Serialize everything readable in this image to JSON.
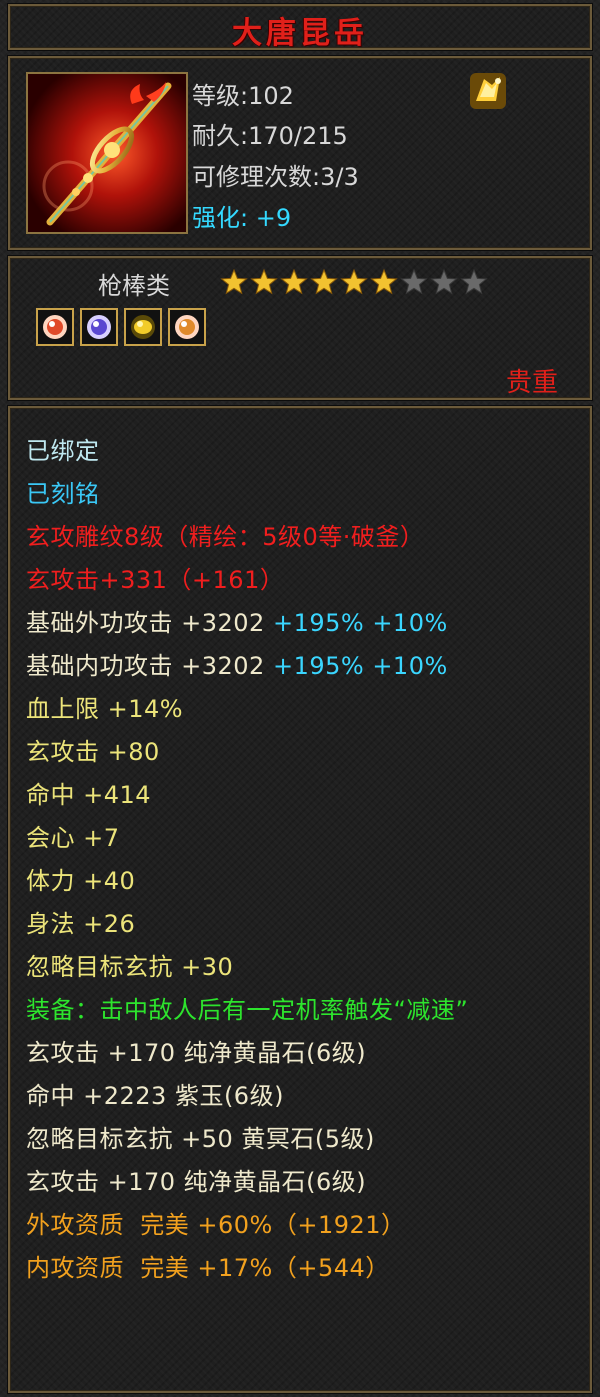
{
  "item": {
    "name": "大唐昆岳",
    "level": "等级:102",
    "durability": "耐久:170/215",
    "repairs": "可修理次数:3/3",
    "enhance_label": "强化:",
    "enhance_value": "+9",
    "category": "枪棒类",
    "rarity": "贵重"
  },
  "stars": {
    "total": 9,
    "filled": 6
  },
  "gems": [
    {
      "icon": "red-jewel-icon"
    },
    {
      "icon": "purple-jewel-icon"
    },
    {
      "icon": "yellow-jewel-icon"
    },
    {
      "icon": "red-jewel-icon"
    }
  ],
  "colors": {
    "title": "#e0201a",
    "enhance": "#34d9ff",
    "bound": "#bfe8f0",
    "engraved": "#3ac8f6",
    "carving": "#f01e1e",
    "stat": "#efe9cc",
    "effect": "#2de42d",
    "gemline": "#ece47a",
    "quality": "#f2a11e",
    "percent": "#3ad6ff"
  },
  "attributes": {
    "bound": "已绑定",
    "engraved": "已刻铭",
    "carving": "玄攻雕纹8级（精绘：5级0等·破釜）",
    "xuan_attack": "玄攻击+331（+161）",
    "outer_attack": {
      "label": "基础外功攻击 +3202",
      "bonus": "+195% +10%"
    },
    "inner_attack": {
      "label": "基础内功攻击 +3202",
      "bonus": "+195% +10%"
    },
    "stats": [
      "血上限 +14%",
      "玄攻击 +80",
      "命中 +414",
      "会心 +7",
      "体力 +40",
      "身法 +26",
      "忽略目标玄抗 +30"
    ],
    "equip_effect": "装备：击中敌人后有一定机率触发“减速”",
    "gem_stats": [
      "玄攻击 +170 纯净黄晶石(6级)",
      "命中 +2223 紫玉(6级)",
      "忽略目标玄抗 +50 黄冥石(5级)",
      "玄攻击 +170 纯净黄晶石(6级)"
    ],
    "qualities": [
      "外攻资质  完美 +60%（+1921）",
      "内攻资质  完美 +17%（+544）"
    ]
  }
}
